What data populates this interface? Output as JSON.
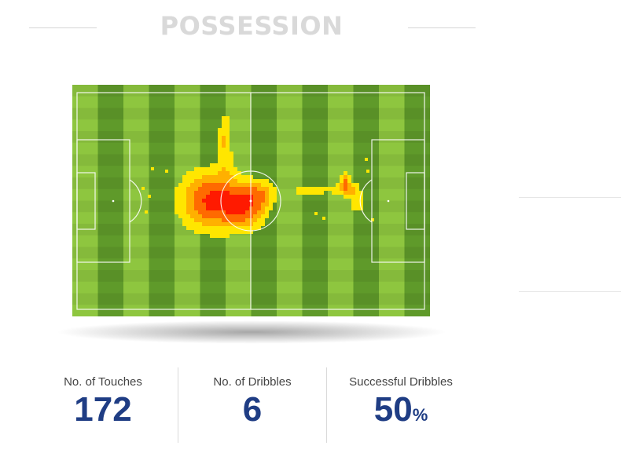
{
  "title": "POSSESSION",
  "heatmap": {
    "colors": {
      "grass_light": "#8ec63f",
      "grass_dark": "#5f9a2a",
      "low": "#ffe600",
      "mid": "#ffb000",
      "high": "#ff6a00",
      "peak": "#ff1a00"
    }
  },
  "stats": [
    {
      "label": "No. of Touches",
      "value": "172",
      "unit": ""
    },
    {
      "label": "No. of Dribbles",
      "value": "6",
      "unit": ""
    },
    {
      "label": "Successful Dribbles",
      "value": "50",
      "unit": "%"
    }
  ],
  "colors": {
    "value_text": "#1f3d84",
    "title_text": "#d9d9d9"
  }
}
